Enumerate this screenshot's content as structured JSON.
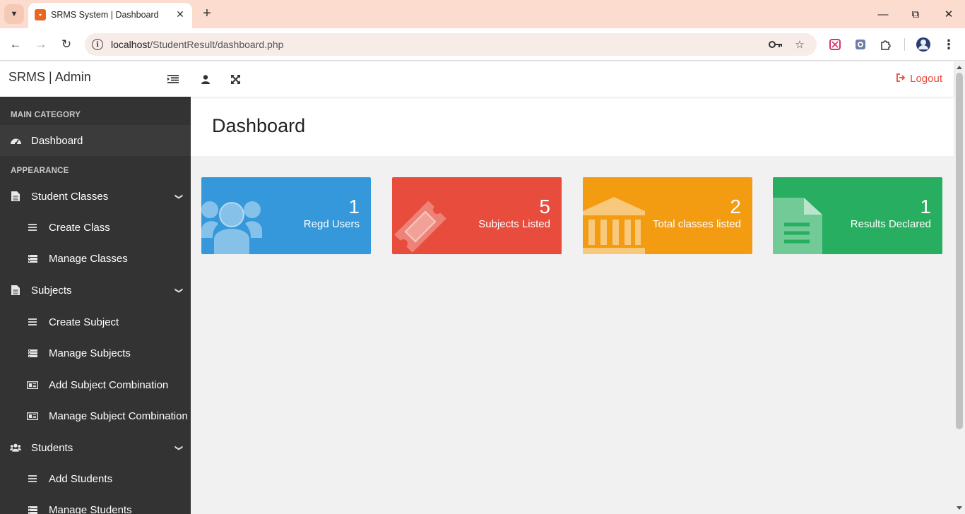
{
  "browser": {
    "tab_title": "SRMS System | Dashboard",
    "url_host": "localhost",
    "url_path": "/StudentResult/dashboard.php"
  },
  "header": {
    "brand": "SRMS | Admin",
    "logout_label": "Logout"
  },
  "sidebar": {
    "main_category": "MAIN CATEGORY",
    "appearance": "APPEARANCE",
    "dashboard": "Dashboard",
    "student_classes": "Student Classes",
    "create_class": "Create Class",
    "manage_classes": "Manage Classes",
    "subjects": "Subjects",
    "create_subject": "Create Subject",
    "manage_subjects": "Manage Subjects",
    "add_subject_combination": "Add Subject Combination",
    "manage_subject_combination": "Manage Subject Combination",
    "students": "Students",
    "add_students": "Add Students",
    "manage_students": "Manage Students"
  },
  "page": {
    "title": "Dashboard"
  },
  "stats": [
    {
      "value": "1",
      "label": "Regd Users",
      "color": "#3498db",
      "icon": "users-icon"
    },
    {
      "value": "5",
      "label": "Subjects Listed",
      "color": "#e74c3c",
      "icon": "ticket-icon"
    },
    {
      "value": "2",
      "label": "Total classes listed",
      "color": "#f39c12",
      "icon": "bank-icon"
    },
    {
      "value": "1",
      "label": "Results Declared",
      "color": "#27ae60",
      "icon": "file-icon"
    }
  ]
}
